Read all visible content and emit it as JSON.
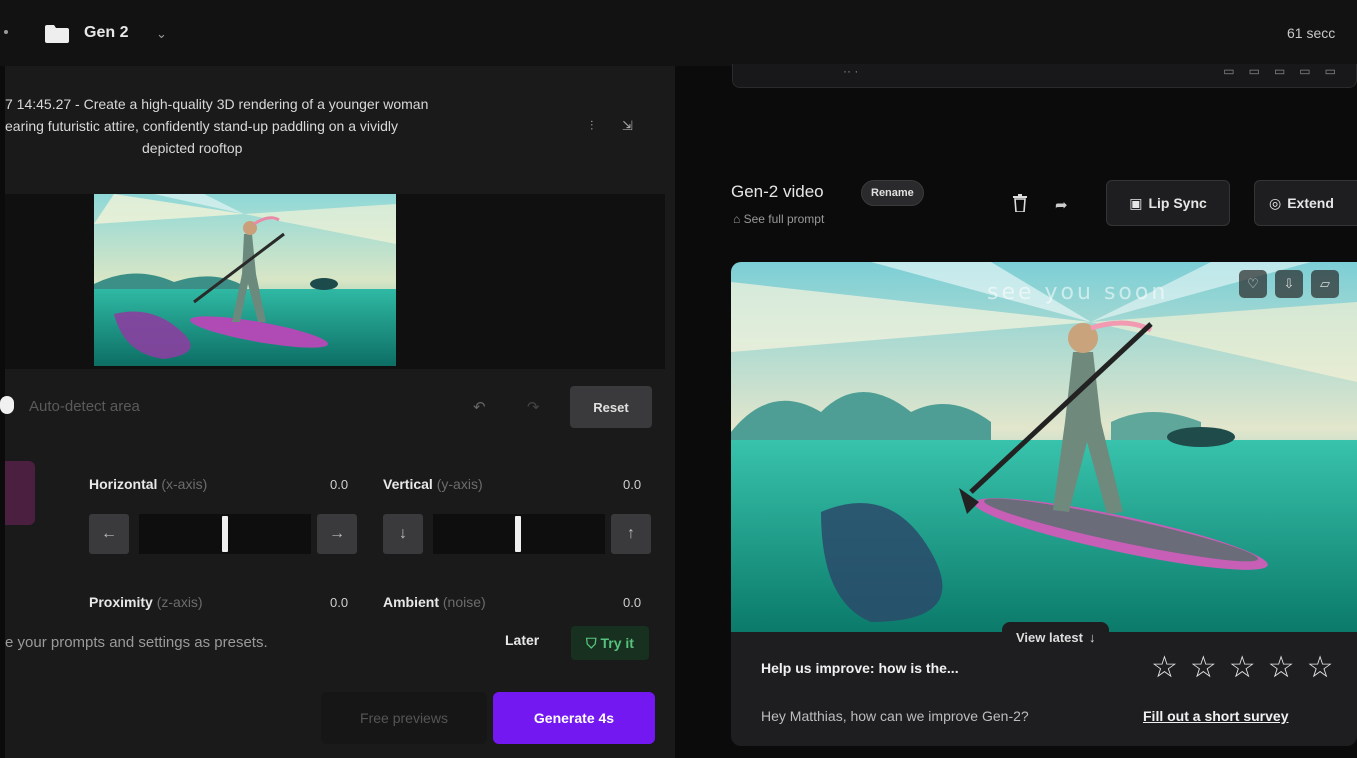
{
  "topbar": {
    "project_name": "Gen 2",
    "credits_text": "61 secc"
  },
  "left": {
    "prompt_lines": [
      "7 14:45.27 - Create a high-quality 3D rendering of a younger woman",
      "earing futuristic attire, confidently stand-up paddling on a vividly",
      "depicted rooftop"
    ],
    "auto_detect_label": "Auto-detect area",
    "reset_label": "Reset",
    "controls": {
      "horizontal": {
        "label": "Horizontal",
        "sub": "(x-axis)",
        "value": "0.0"
      },
      "vertical": {
        "label": "Vertical",
        "sub": "(y-axis)",
        "value": "0.0"
      },
      "proximity": {
        "label": "Proximity",
        "sub": "(z-axis)",
        "value": "0.0"
      },
      "ambient": {
        "label": "Ambient",
        "sub": "(noise)",
        "value": "0.0"
      }
    },
    "preset_text": "e your prompts and settings as presets.",
    "later_label": "Later",
    "tryit_label": "Try it",
    "free_previews_label": "Free previews",
    "generate_label": "Generate 4s"
  },
  "right": {
    "video_title": "Gen-2 video",
    "rename_label": "Rename",
    "see_prompt_label": "See full prompt",
    "lipsync_label": "Lip Sync",
    "extend_label": "Extend",
    "overlay_text": "see you soon",
    "view_latest_label": "View latest",
    "survey_question": "Help us improve: how is the...",
    "survey_message": "Hey Matthias, how can we improve Gen-2?",
    "survey_link": "Fill out a short survey"
  },
  "colors": {
    "accent_purple": "#7418f2",
    "tryit_green": "#57c27d"
  }
}
